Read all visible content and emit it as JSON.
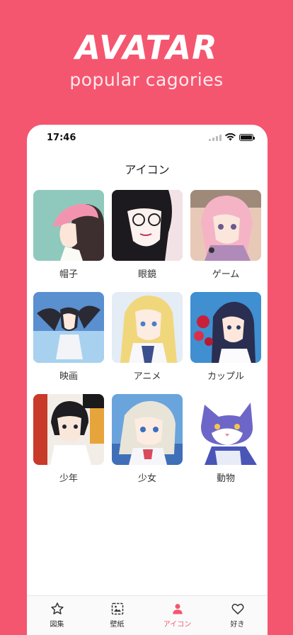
{
  "promo": {
    "title": "AVATAR",
    "subtitle": "popular cagories"
  },
  "status_bar": {
    "time": "17:46"
  },
  "page": {
    "title": "アイコン"
  },
  "categories": [
    {
      "label": "帽子",
      "icon": "girl-pink-beanie-image"
    },
    {
      "label": "眼鏡",
      "icon": "girl-glasses-image"
    },
    {
      "label": "ゲーム",
      "icon": "pink-hair-girl-image"
    },
    {
      "label": "映画",
      "icon": "twin-tail-girl-image"
    },
    {
      "label": "アニメ",
      "icon": "blonde-girl-image"
    },
    {
      "label": "カップル",
      "icon": "girl-with-roses-image"
    },
    {
      "label": "少年",
      "icon": "black-hair-boy-image"
    },
    {
      "label": "少女",
      "icon": "silver-hair-girl-image"
    },
    {
      "label": "動物",
      "icon": "cat-image"
    }
  ],
  "tabbar": {
    "items": [
      {
        "label": "図集",
        "icon": "star-icon",
        "active": false
      },
      {
        "label": "壁紙",
        "icon": "wallpaper-icon",
        "active": false
      },
      {
        "label": "アイコン",
        "icon": "person-icon",
        "active": true
      },
      {
        "label": "好き",
        "icon": "heart-icon",
        "active": false
      }
    ]
  },
  "colors": {
    "background": "#f5566f",
    "accent": "#f5566f",
    "card": "#ffffff"
  }
}
